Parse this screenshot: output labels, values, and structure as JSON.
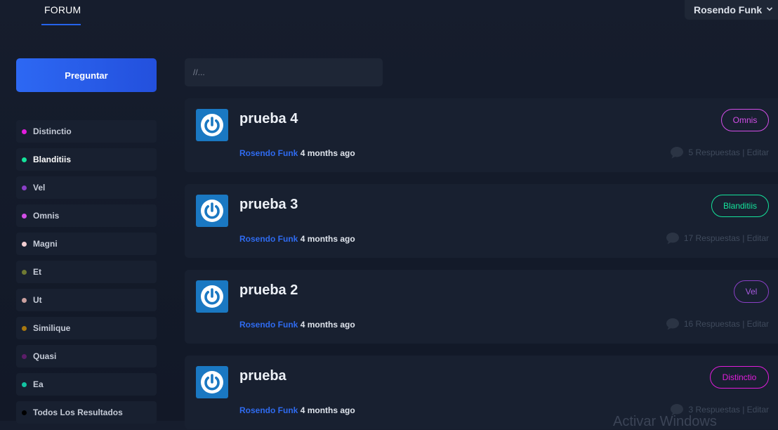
{
  "nav": {
    "forum_label": "FORUM"
  },
  "user": {
    "name": "Rosendo Funk"
  },
  "sidebar": {
    "ask_label": "Preguntar",
    "categories": [
      {
        "label": "Distinctio",
        "color": "#e11ddc"
      },
      {
        "label": "Blanditiis",
        "color": "#14e39b"
      },
      {
        "label": "Vel",
        "color": "#8a3fc6"
      },
      {
        "label": "Omnis",
        "color": "#d34ee8"
      },
      {
        "label": "Magni",
        "color": "#f3cfd3"
      },
      {
        "label": "Et",
        "color": "#6f7a33"
      },
      {
        "label": "Ut",
        "color": "#caa09f"
      },
      {
        "label": "Similique",
        "color": "#a8780f"
      },
      {
        "label": "Quasi",
        "color": "#5b1d68"
      },
      {
        "label": "Ea",
        "color": "#12c4a2"
      },
      {
        "label": "Todos Los Resultados",
        "color": "#000000"
      }
    ]
  },
  "search": {
    "placeholder": "//..."
  },
  "threads": [
    {
      "title": "prueba 4",
      "author": "Rosendo Funk",
      "ago": "4 months ago",
      "tag": "Omnis",
      "tag_color": "#d34ee8",
      "stats": "5 Respuestas | Editar",
      "avatar_icon": "power-icon"
    },
    {
      "title": "prueba 3",
      "author": "Rosendo Funk",
      "ago": "4 months ago",
      "tag": "Blanditiis",
      "tag_color": "#14e39b",
      "stats": "17 Respuestas | Editar",
      "avatar_icon": "power-icon"
    },
    {
      "title": "prueba 2",
      "author": "Rosendo Funk",
      "ago": "4 months ago",
      "tag": "Vel",
      "tag_color": "#8a3fc6",
      "stats": "16 Respuestas | Editar",
      "avatar_icon": "power-icon"
    },
    {
      "title": "prueba",
      "author": "Rosendo Funk",
      "ago": "4 months ago",
      "tag": "Distinctio",
      "tag_color": "#e11ddc",
      "stats": "3 Respuestas | Editar",
      "avatar_icon": "power-icon"
    }
  ],
  "watermark": "Activar Windows"
}
